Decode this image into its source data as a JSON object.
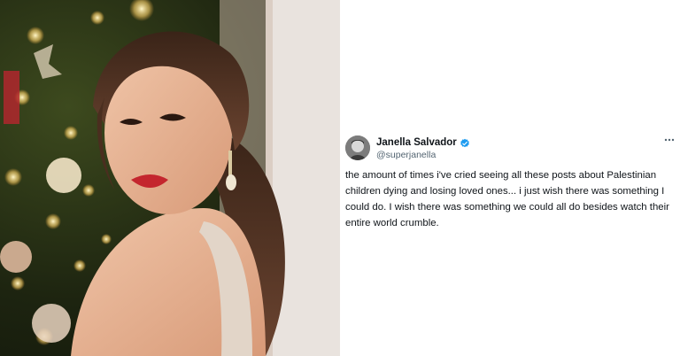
{
  "tweet": {
    "author_name": "Janella Salvador",
    "author_handle": "@superjanella",
    "verified": true,
    "more_icon": "more-horizontal-icon",
    "text": "the amount of times i've cried seeing all these posts about Palestinian children dying and losing loved ones... i just wish there was something I could do. I wish there was something we could all do besides watch their entire world crumble."
  },
  "colors": {
    "text_primary": "#0f1419",
    "text_secondary": "#536471",
    "verified_badge": "#1d9bf0",
    "lipstick": "#c4262e"
  }
}
